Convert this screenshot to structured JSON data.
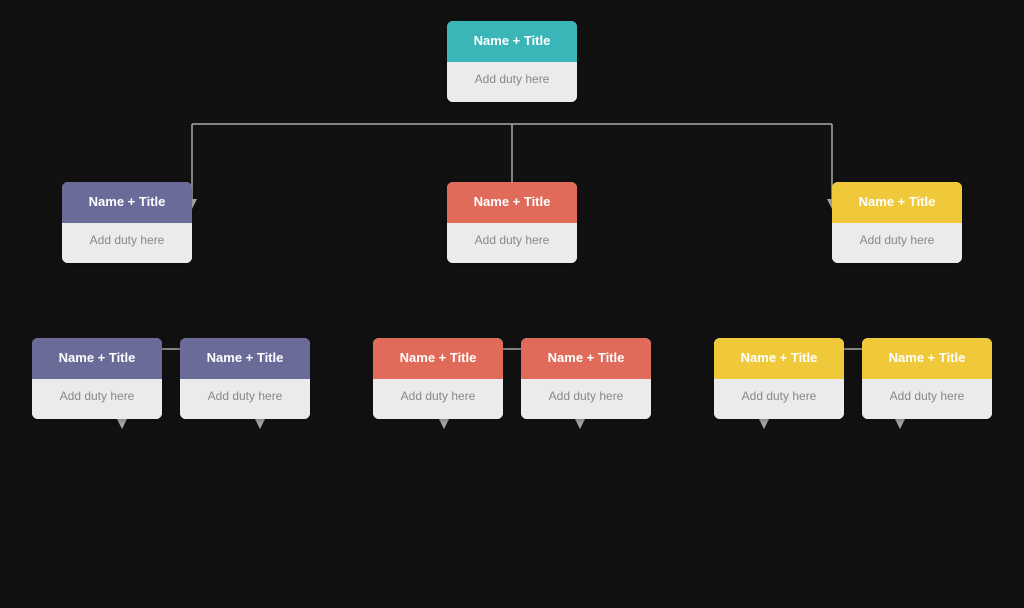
{
  "colors": {
    "teal": "#3ab5b8",
    "purple": "#6b6b9a",
    "coral": "#e06b5a",
    "yellow": "#f0c93a",
    "body_bg": "#ebebeb",
    "text_muted": "#999"
  },
  "nodes": {
    "root": {
      "header": "Name + Title",
      "body": "Add duty here",
      "color": "teal"
    },
    "level1": [
      {
        "header": "Name + Title",
        "body": "Add duty here",
        "color": "purple"
      },
      {
        "header": "Name + Title",
        "body": "Add duty here",
        "color": "coral"
      },
      {
        "header": "Name + Title",
        "body": "Add duty here",
        "color": "yellow"
      }
    ],
    "level2": [
      [
        {
          "header": "Name + Title",
          "body": "Add duty here",
          "color": "purple"
        },
        {
          "header": "Name + Title",
          "body": "Add duty here",
          "color": "purple"
        }
      ],
      [
        {
          "header": "Name + Title",
          "body": "Add duty here",
          "color": "coral"
        },
        {
          "header": "Name + Title",
          "body": "Add duty here",
          "color": "coral"
        }
      ],
      [
        {
          "header": "Name + Title",
          "body": "Add duty here",
          "color": "yellow"
        },
        {
          "header": "Name + Title",
          "body": "Add duty here",
          "color": "yellow"
        }
      ]
    ]
  }
}
